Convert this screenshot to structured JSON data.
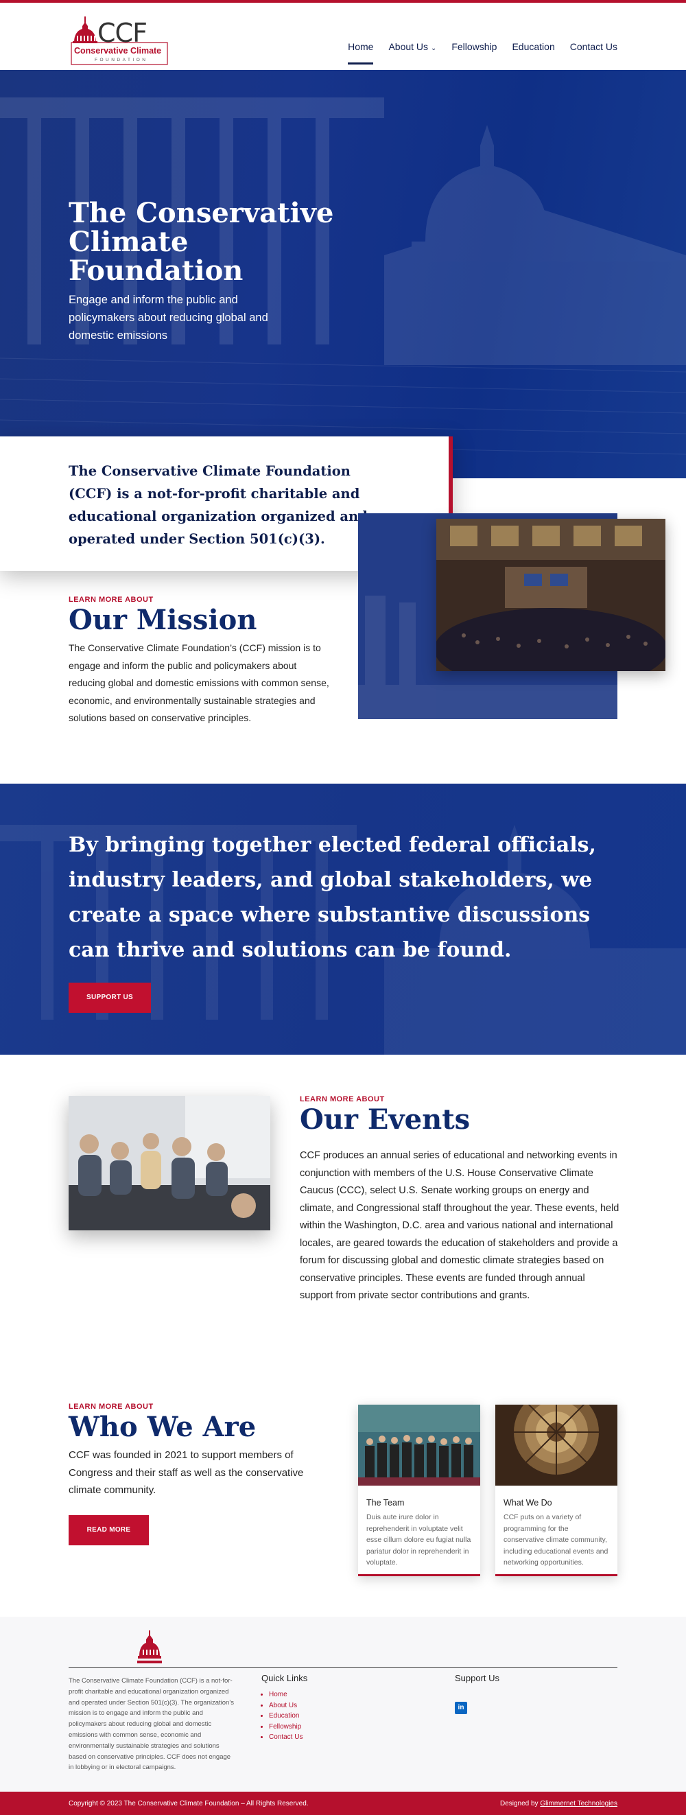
{
  "header": {
    "logo": {
      "letters": "CCF",
      "name": "Conservative Climate",
      "tagline": "FOUNDATION"
    },
    "nav": [
      {
        "label": "Home",
        "active": true
      },
      {
        "label": "About Us",
        "caret": "⌄"
      },
      {
        "label": "Fellowship"
      },
      {
        "label": "Education"
      },
      {
        "label": "Contact Us"
      }
    ]
  },
  "hero": {
    "title": "The Conservative Climate Foundation",
    "subtitle": "Engage and inform the public and policymakers about reducing global and domestic emissions"
  },
  "intro": {
    "text": "The Conservative Climate Foundation (CCF) is a not-for-profit charitable and educational organization organized and operated under Section 501(c)(3)."
  },
  "mission": {
    "eyebrow": "LEARN MORE ABOUT",
    "title": "Our Mission",
    "text": "The Conservative Climate Foundation’s (CCF) mission is to engage and inform the public and policymakers about reducing global and domestic emissions with common sense, economic, and environmentally sustainable strategies and solutions based on conservative principles."
  },
  "band": {
    "text": "By bringing together elected federal officials, industry leaders, and global stakeholders, we create a space where substantive discussions can thrive and solutions can be found.",
    "button": "SUPPORT US"
  },
  "events": {
    "eyebrow": "LEARN MORE ABOUT",
    "title": "Our Events",
    "text": "CCF produces an annual series of educational and networking events in conjunction with members of the U.S. House Conservative Climate Caucus (CCC), select U.S. Senate working groups on energy and climate, and Congressional staff throughout the year. These events, held within the Washington, D.C. area and various national and international locales, are geared towards the education of stakeholders and provide a forum for discussing global and domestic climate strategies based on conservative principles. These events are funded through annual support from private sector contributions and grants."
  },
  "who": {
    "eyebrow": "LEARN MORE ABOUT",
    "title": "Who We Are",
    "text": "CCF was founded in 2021 to support members of Congress and their staff as well as the conservative climate community.",
    "button": "READ MORE",
    "cards": [
      {
        "title": "The Team",
        "text": "Duis aute irure dolor in reprehenderit in voluptate velit esse cillum dolore eu fugiat nulla pariatur dolor in reprehenderit in voluptate."
      },
      {
        "title": "What We Do",
        "text": "CCF puts on a variety of programming for the conservative climate community, including educational events and networking opportunities."
      }
    ]
  },
  "footer": {
    "about": "The Conservative Climate Foundation (CCF) is a not-for-profit charitable and educational organization organized and operated under Section 501(c)(3). The organization’s mission is to engage and inform the public and policymakers about reducing global and domestic emissions with common sense, economic and environmentally sustainable strategies and solutions based on conservative principles. CCF does not engage in lobbying or in electoral campaigns.",
    "quick_links_title": "Quick Links",
    "quick_links": [
      "Home",
      "About Us",
      "Education",
      "Fellowship",
      "Contact Us"
    ],
    "support_title": "Support Us",
    "linkedin": "in",
    "copyright": "Copyright © 2023 The Conservative Climate Foundation – All Rights Reserved.",
    "designed_by": "Designed by",
    "designer": "Glimmernet Technologies"
  },
  "colors": {
    "brand_red": "#b5102d",
    "navy": "#0f2a6b",
    "hero_blue": "#17348a"
  }
}
